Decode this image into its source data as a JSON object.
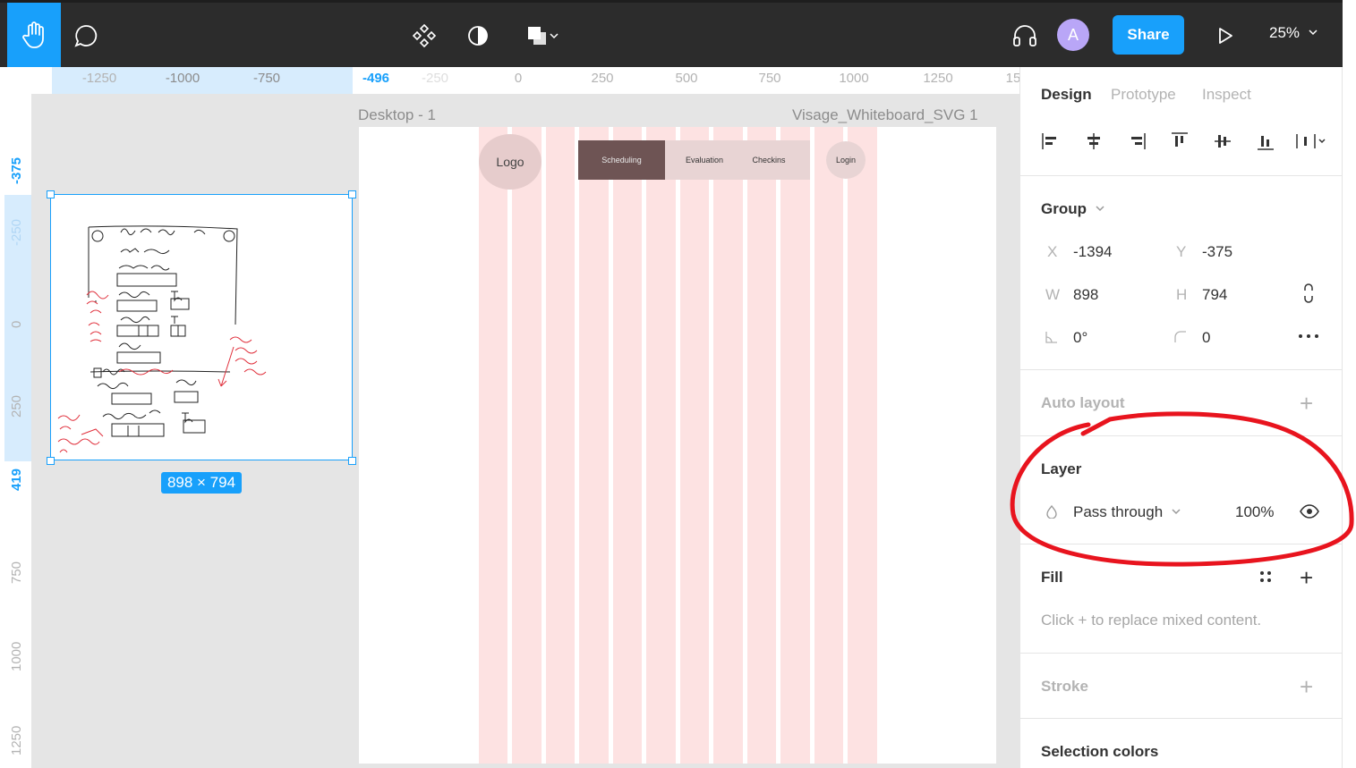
{
  "toolbar": {
    "share_label": "Share",
    "avatar_initial": "A",
    "zoom_label": "25%",
    "accent_color": "#18a0fb"
  },
  "rulers": {
    "top_ticks": [
      "-1250",
      "-1000",
      "-750",
      "-496",
      "-250",
      "0",
      "250",
      "500",
      "750",
      "1000",
      "1250",
      "15"
    ],
    "left_ticks": [
      "-375",
      "-250",
      "0",
      "250",
      "419",
      "750",
      "1000",
      "1250"
    ]
  },
  "canvas": {
    "frame_title": "Desktop - 1",
    "layer_title": "Visage_Whiteboard_SVG 1",
    "selection_size": "898 × 794",
    "mockup": {
      "logo": "Logo",
      "nav_items": [
        "Scheduling",
        "Evaluation",
        "Checkins"
      ],
      "login": "Login"
    }
  },
  "panel": {
    "tabs": [
      "Design",
      "Prototype",
      "Inspect"
    ],
    "group_label": "Group",
    "x_label": "X",
    "x_value": "-1394",
    "y_label": "Y",
    "y_value": "-375",
    "w_label": "W",
    "w_value": "898",
    "h_label": "H",
    "h_value": "794",
    "rotation_value": "0°",
    "radius_value": "0",
    "auto_layout_label": "Auto layout",
    "layer_label": "Layer",
    "blend_mode": "Pass through",
    "opacity": "100%",
    "fill_label": "Fill",
    "fill_hint": "Click + to replace mixed content.",
    "stroke_label": "Stroke",
    "selection_colors_label": "Selection colors"
  }
}
